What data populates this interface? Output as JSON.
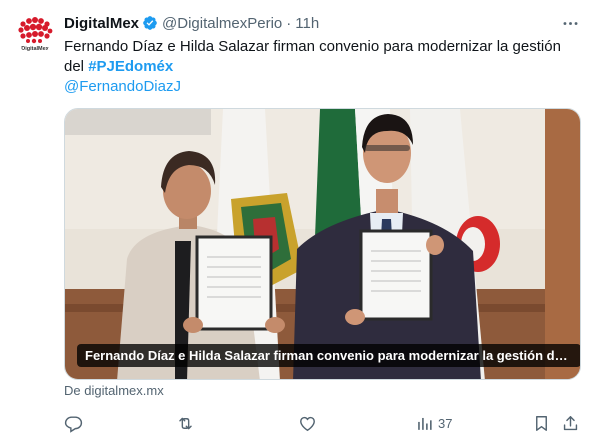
{
  "author": {
    "display_name": "DigitalMex",
    "handle": "@DigitalmexPerio",
    "separator": "·",
    "time": "11h",
    "avatar_text": "DigitalMex"
  },
  "tweet": {
    "text_part1": "Fernando Díaz e Hilda Salazar firman convenio para modernizar la gestión del ",
    "hashtag": "#PJEdoméx",
    "mention": "@FernandoDiazJ"
  },
  "media": {
    "caption": "Fernando Díaz e Hilda Salazar firman convenio para modernizar la gestión del ..."
  },
  "link_source": "De digitalmex.mx",
  "actions": {
    "views_count": "37"
  },
  "icons": {
    "verified": "verified-badge-icon",
    "more": "more-icon",
    "reply": "reply-icon",
    "retweet": "retweet-icon",
    "like": "like-icon",
    "views": "views-icon",
    "bookmark": "bookmark-icon",
    "share": "share-icon"
  },
  "colors": {
    "accent": "#1d9bf0",
    "secondary_text": "#536471",
    "primary_text": "#0f1419",
    "brand_red": "#d61a2b"
  }
}
